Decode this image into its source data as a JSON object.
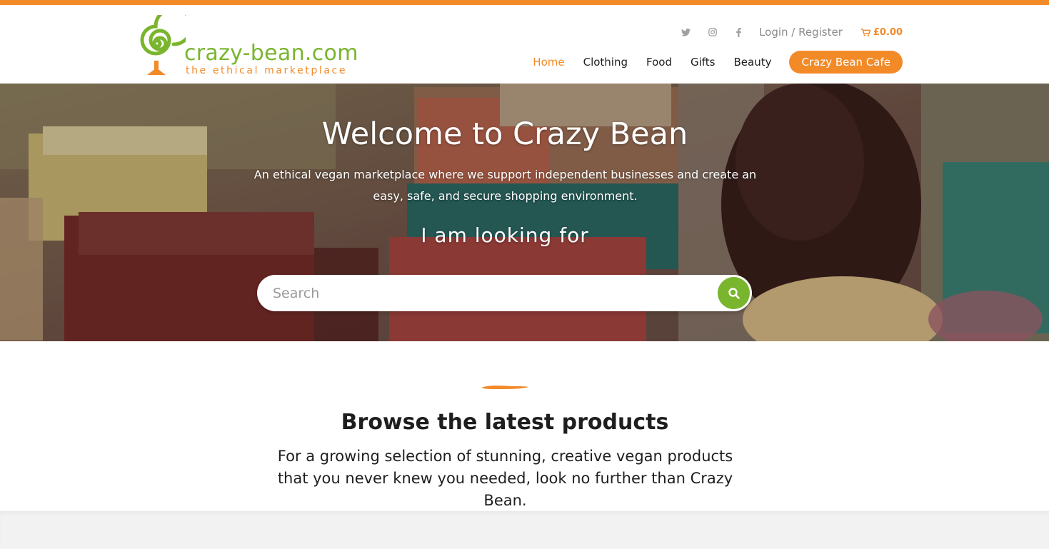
{
  "brand": {
    "name": "crazy-bean.com",
    "tagline": "the ethical marketplace",
    "colors": {
      "orange": "#f28a28",
      "green": "#7ab52e"
    }
  },
  "utility": {
    "icons": [
      "twitter-icon",
      "instagram-icon",
      "facebook-icon"
    ],
    "login_label": "Login / Register",
    "cart_total": "£0.00"
  },
  "nav": {
    "items": [
      {
        "label": "Home",
        "active": true
      },
      {
        "label": "Clothing"
      },
      {
        "label": "Food"
      },
      {
        "label": "Gifts"
      },
      {
        "label": "Beauty"
      }
    ],
    "cta_label": "Crazy Bean Cafe"
  },
  "hero": {
    "title": "Welcome to Crazy Bean",
    "subtitle": "An ethical vegan marketplace where we support independent businesses and create an easy, safe, and secure shopping environment.",
    "looking_for": "I am looking for",
    "search_placeholder": "Search"
  },
  "browse": {
    "title": "Browse the latest products",
    "text": "For a growing selection of stunning, creative vegan products that you never knew you needed, look no further than Crazy Bean."
  }
}
